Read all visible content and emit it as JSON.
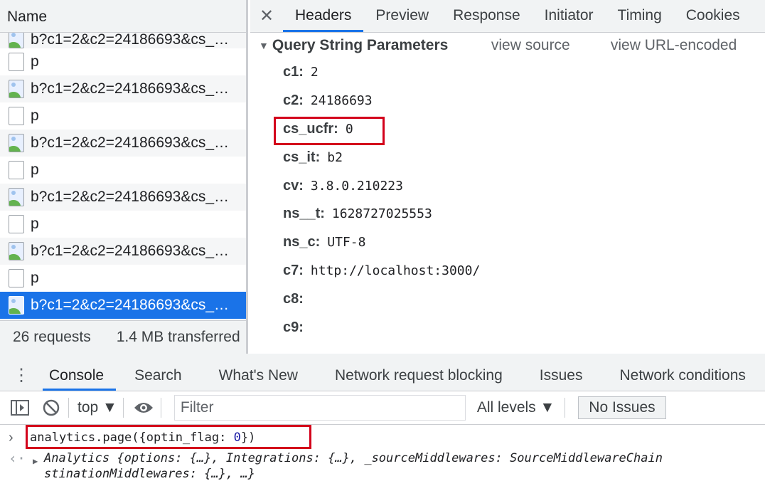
{
  "network": {
    "name_header": "Name",
    "requests": [
      {
        "name": "b?c1=2&c2=24186693&cs_…",
        "type": "img"
      },
      {
        "name": "p",
        "type": "doc"
      },
      {
        "name": "b?c1=2&c2=24186693&cs_…",
        "type": "img"
      },
      {
        "name": "p",
        "type": "doc"
      },
      {
        "name": "b?c1=2&c2=24186693&cs_…",
        "type": "img"
      },
      {
        "name": "p",
        "type": "doc"
      },
      {
        "name": "b?c1=2&c2=24186693&cs_…",
        "type": "img"
      },
      {
        "name": "p",
        "type": "doc"
      },
      {
        "name": "b?c1=2&c2=24186693&cs_…",
        "type": "img"
      },
      {
        "name": "p",
        "type": "doc"
      },
      {
        "name": "b?c1=2&c2=24186693&cs_…",
        "type": "img",
        "selected": true
      }
    ],
    "status": {
      "requests": "26 requests",
      "transferred": "1.4 MB transferred"
    }
  },
  "details": {
    "close_glyph": "✕",
    "tabs": [
      "Headers",
      "Preview",
      "Response",
      "Initiator",
      "Timing",
      "Cookies"
    ],
    "active_tab": "Headers",
    "section": {
      "triangle": "▼",
      "title": "Query String Parameters",
      "view_source": "view source",
      "view_url_encoded": "view URL-encoded"
    },
    "params": [
      {
        "key": "c1:",
        "value": "2"
      },
      {
        "key": "c2:",
        "value": "24186693"
      },
      {
        "key": "cs_ucfr:",
        "value": "0",
        "highlight": true
      },
      {
        "key": "cs_it:",
        "value": "b2"
      },
      {
        "key": "cv:",
        "value": "3.8.0.210223"
      },
      {
        "key": "ns__t:",
        "value": "1628727025553"
      },
      {
        "key": "ns_c:",
        "value": "UTF-8"
      },
      {
        "key": "c7:",
        "value": "http://localhost:3000/"
      },
      {
        "key": "c8:",
        "value": ""
      },
      {
        "key": "c9:",
        "value": ""
      }
    ]
  },
  "drawer": {
    "menu_glyph": "⋮",
    "tabs": [
      "Console",
      "Search",
      "What's New",
      "Network request blocking",
      "Issues",
      "Network conditions"
    ],
    "active_tab": "Console",
    "toolbar": {
      "context": "top ▼",
      "filter_placeholder": "Filter",
      "levels": "All levels ▼",
      "no_issues": "No Issues"
    },
    "console": {
      "input_prompt": "›",
      "command_prefix": "analytics.page({optin_flag: ",
      "command_number": "0",
      "command_suffix": "})",
      "result_back_arrow": "‹·",
      "result_caret": "▶",
      "result_line1": "Analytics {options: {…}, Integrations: {…}, _sourceMiddlewares: SourceMiddlewareChain",
      "result_line2": "stinationMiddlewares: {…}, …}"
    }
  },
  "colors": {
    "accent": "#1a73e8",
    "highlight_box": "#d3001b",
    "toolbar_bg": "#f1f3f4"
  }
}
